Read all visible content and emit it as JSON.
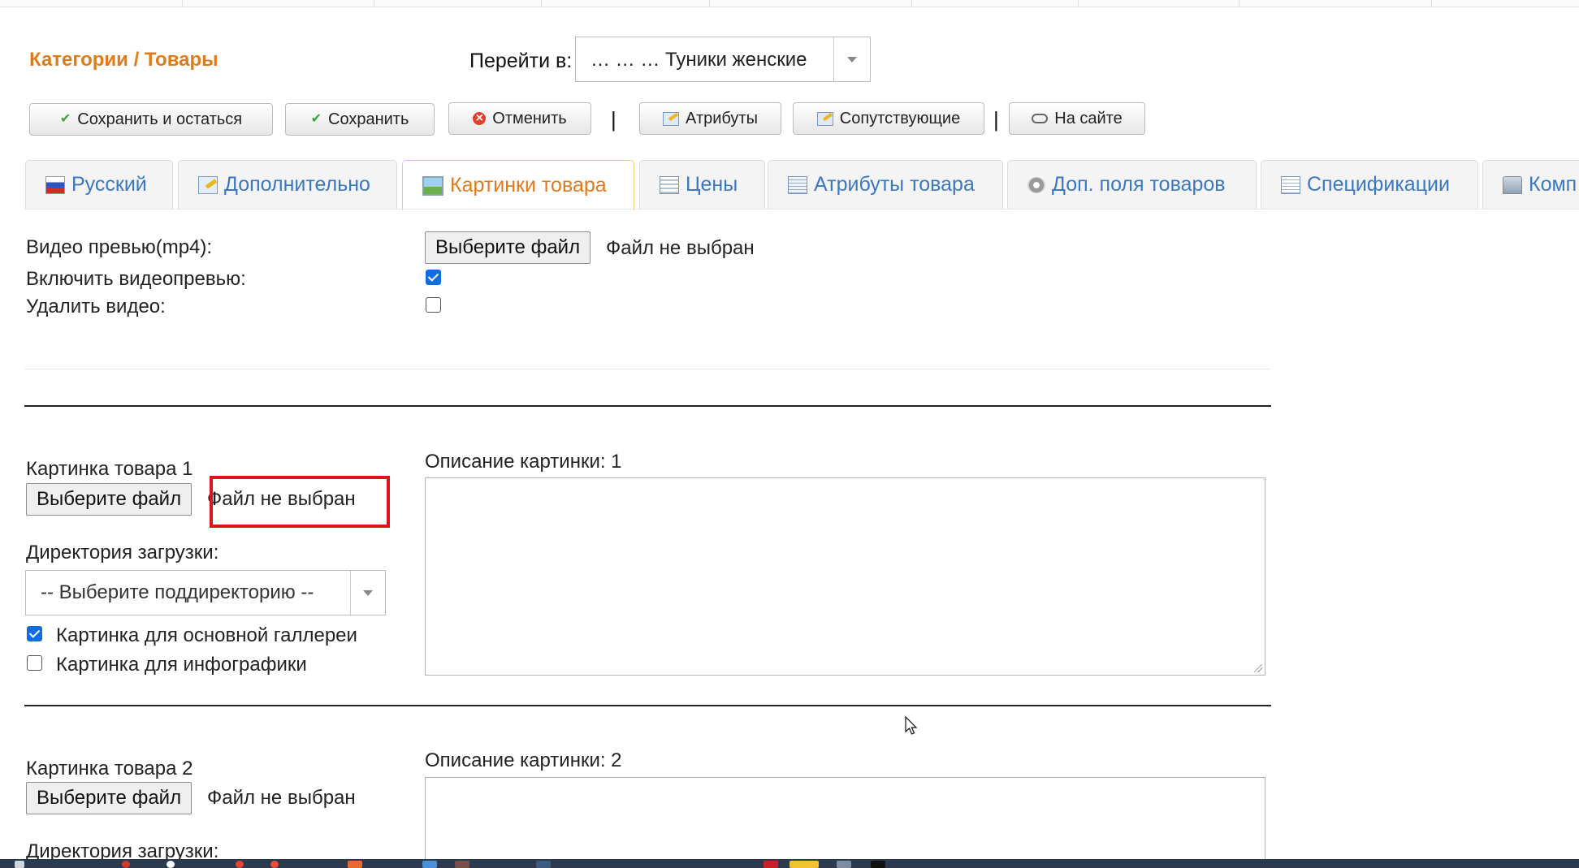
{
  "breadcrumb": "Категории / Товары",
  "goto": {
    "label": "Перейти в:",
    "value": "… … … Туники женские"
  },
  "toolbar": {
    "save_stay": "Сохранить и остаться",
    "save": "Сохранить",
    "cancel": "Отменить",
    "separator": "|",
    "attributes": "Атрибуты",
    "related": "Сопутствующие",
    "on_site": "На сайте"
  },
  "tabs": [
    {
      "label": "Русский",
      "icon": "flag-ru-icon"
    },
    {
      "label": "Дополнительно",
      "icon": "edit-note-icon"
    },
    {
      "label": "Картинки товара",
      "icon": "image-icon"
    },
    {
      "label": "Цены",
      "icon": "calculator-icon"
    },
    {
      "label": "Атрибуты товара",
      "icon": "table-icon"
    },
    {
      "label": "Доп. поля товаров",
      "icon": "gear-icon"
    },
    {
      "label": "Спецификации",
      "icon": "spec-list-icon"
    },
    {
      "label": "Комп",
      "icon": "components-icon"
    }
  ],
  "active_tab": "Картинки товара",
  "video": {
    "preview_label": "Видео превью(mp4):",
    "choose_button": "Выберите файл",
    "file_status": "Файл не выбран",
    "enable_label": "Включить видеопревью:",
    "enable_checked": true,
    "delete_label": "Удалить видео:",
    "delete_checked": false
  },
  "images": [
    {
      "title": "Картинка товара 1",
      "choose_button": "Выберите файл",
      "file_status": "Файл не выбран",
      "dir_label": "Директория загрузки:",
      "dir_placeholder": "-- Выберите поддиректорию --",
      "gallery_label": "Картинка для основной галлереи",
      "gallery_checked": true,
      "infographic_label": "Картинка для инфографики",
      "infographic_checked": false,
      "description_label": "Описание картинки: 1"
    },
    {
      "title": "Картинка товара 2",
      "choose_button": "Выберите файл",
      "file_status": "Файл не выбран",
      "dir_label": "Директория загрузки:",
      "description_label": "Описание картинки: 2"
    }
  ],
  "colors": {
    "accent_orange": "#e07b1a",
    "tab_blue": "#3b78c4",
    "highlight_red": "#e0131b",
    "checkbox_blue": "#0f6de0"
  }
}
